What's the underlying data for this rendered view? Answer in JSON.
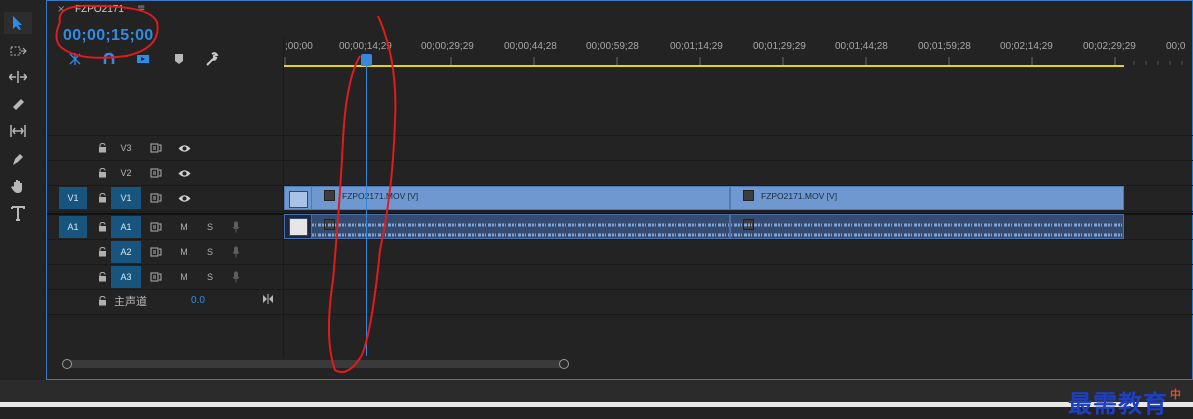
{
  "sequence": {
    "name": "FZPO2171",
    "close_glyph": "×",
    "menu_glyph": "≡",
    "timecode": "00;00;15;00"
  },
  "ruler": {
    "labels": [
      ";00;00",
      "00;00;14;29",
      "00;00;29;29",
      "00;00;44;28",
      "00;00;59;28",
      "00;01;14;29",
      "00;01;29;29",
      "00;01;44;28",
      "00;01;59;28",
      "00;02;14;29",
      "00;02;29;29",
      "00;0"
    ]
  },
  "tracks": {
    "video": [
      {
        "id": "V3",
        "source": ""
      },
      {
        "id": "V2",
        "source": ""
      },
      {
        "id": "V1",
        "source": "V1"
      }
    ],
    "audio": [
      {
        "id": "A1",
        "source": "A1",
        "m": "M",
        "s": "S"
      },
      {
        "id": "A2",
        "source": "",
        "m": "M",
        "s": "S"
      },
      {
        "id": "A3",
        "source": "",
        "m": "M",
        "s": "S"
      }
    ],
    "master": {
      "label": "主声道",
      "value": "0.0"
    }
  },
  "clips": [
    {
      "name": "FZPO2171.MOV [V]"
    },
    {
      "name": "FZPO2171.MOV [V]"
    }
  ],
  "watermark": {
    "text": "最需教育",
    "badge": "中"
  },
  "colors": {
    "accent": "#2e8ce6",
    "clip_video": "#6e98cf",
    "clip_audio": "#354b70",
    "work_area": "#e3d320",
    "annotation": "#e01b1b"
  }
}
